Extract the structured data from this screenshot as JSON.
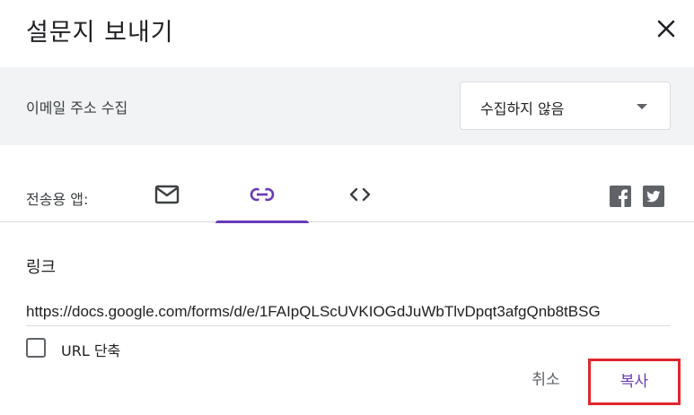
{
  "dialog": {
    "title": "설문지 보내기"
  },
  "email_collection": {
    "label": "이메일 주소 수집",
    "selected_option": "수집하지 않음"
  },
  "send_via": {
    "label": "전송용 앱:",
    "tabs": [
      {
        "name": "email",
        "icon": "mail-icon",
        "active": false
      },
      {
        "name": "link",
        "icon": "link-icon",
        "active": true
      },
      {
        "name": "embed",
        "icon": "code-icon",
        "active": false
      }
    ],
    "active_color": "#673ab7",
    "social": [
      "facebook-icon",
      "twitter-icon"
    ]
  },
  "link_panel": {
    "heading": "링크",
    "url": "https://docs.google.com/forms/d/e/1FAIpQLScUVKIOGdJuWbTlvDpqt3afgQnb8tBSG",
    "shorten_label": "URL 단축",
    "shorten_checked": false
  },
  "actions": {
    "cancel_label": "취소",
    "copy_label": "복사",
    "highlight_color": "#e0282e"
  }
}
